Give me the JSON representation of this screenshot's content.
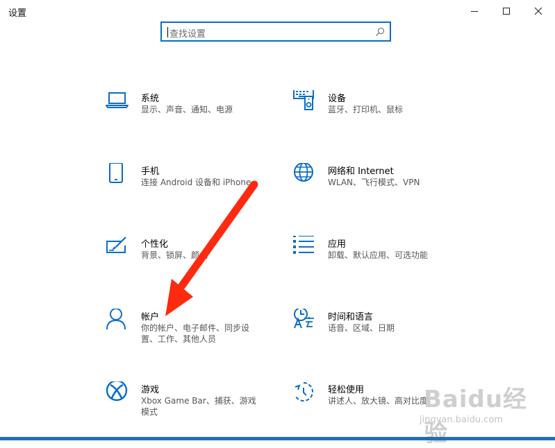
{
  "window": {
    "title": "设置",
    "controls": {
      "minimize": "minimize-icon",
      "maximize": "maximize-icon",
      "close": "close-icon"
    }
  },
  "search": {
    "placeholder": "查找设置"
  },
  "accent": "#0a6cc6",
  "tiles": [
    {
      "name": "系统",
      "desc": "显示、声音、通知、电源",
      "icon": "laptop-icon"
    },
    {
      "name": "设备",
      "desc": "蓝牙、打印机、鼠标",
      "icon": "devices-icon"
    },
    {
      "name": "手机",
      "desc": "连接 Android 设备和 iPhone",
      "icon": "phone-icon"
    },
    {
      "name": "网络和 Internet",
      "desc": "WLAN、飞行模式、VPN",
      "icon": "globe-icon"
    },
    {
      "name": "个性化",
      "desc": "背景、锁屏、颜色",
      "icon": "paint-icon"
    },
    {
      "name": "应用",
      "desc": "卸载、默认应用、可选功能",
      "icon": "apps-list-icon"
    },
    {
      "name": "帐户",
      "desc": "你的帐户、电子邮件、同步设置、工作、其他人员",
      "icon": "person-icon"
    },
    {
      "name": "时间和语言",
      "desc": "语音、区域、日期",
      "icon": "time-language-icon"
    },
    {
      "name": "游戏",
      "desc": "Xbox Game Bar、捕获、游戏模式",
      "icon": "xbox-icon"
    },
    {
      "name": "轻松使用",
      "desc": "讲述人、放大镜、高对比度",
      "icon": "ease-of-access-icon"
    }
  ],
  "watermark": {
    "logo": "Baidu经验",
    "url": "jingyan.baidu.com"
  }
}
